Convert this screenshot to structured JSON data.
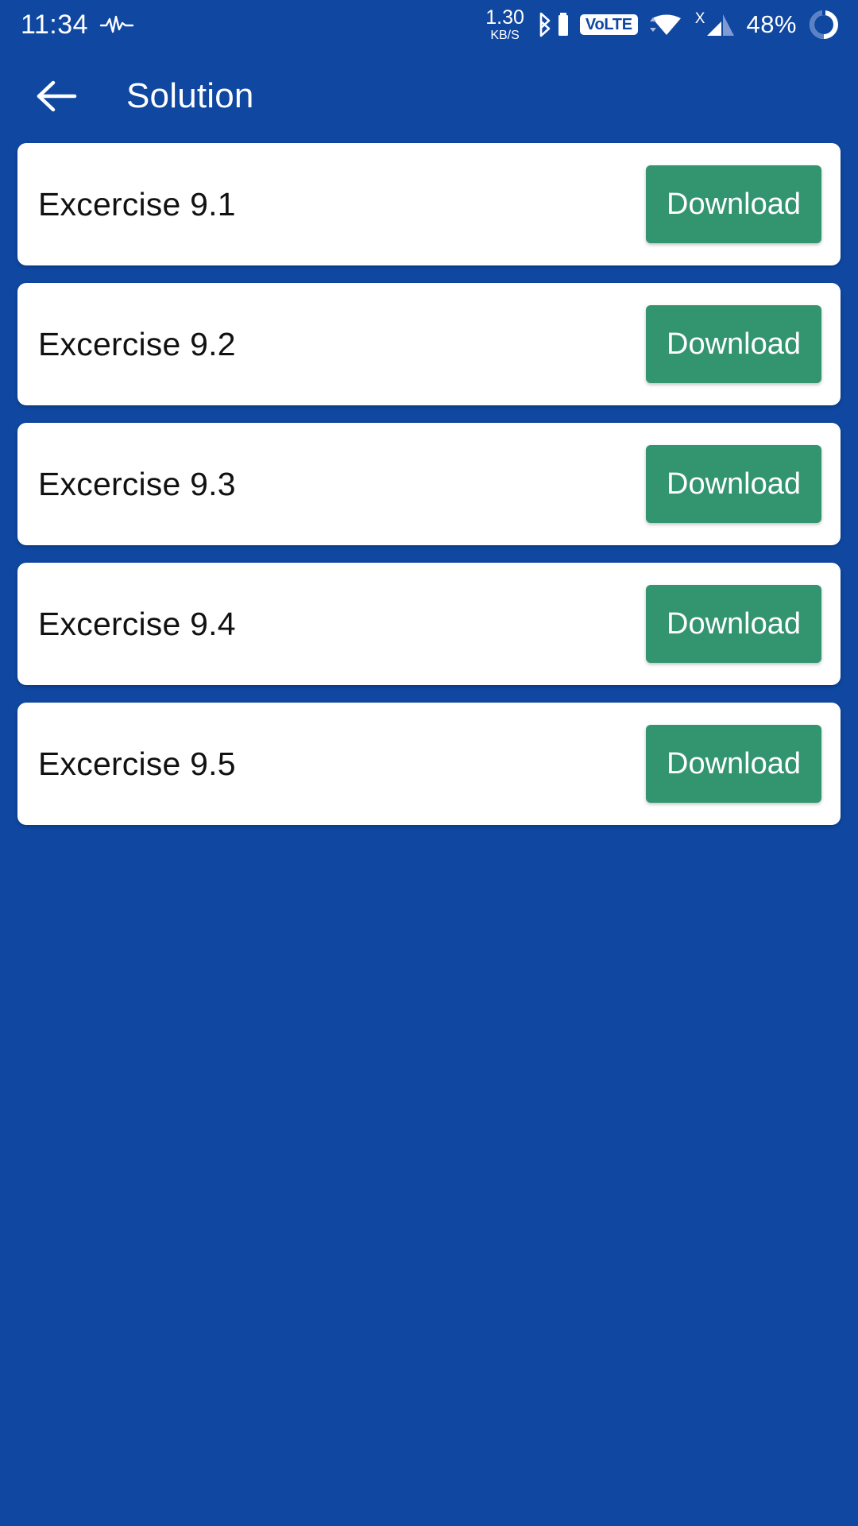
{
  "theme": {
    "background_blue": "#0F47A1",
    "card_white": "#FFFFFF",
    "button_green": "#339470",
    "text_dark": "#111111",
    "text_light": "#FFFFFF"
  },
  "status_bar": {
    "clock": "11:34",
    "pulse_icon": "pulse-icon",
    "network_speed_value": "1.30",
    "network_speed_unit": "KB/S",
    "bluetooth_icon": "bluetooth-icon",
    "bluetooth_battery_icon": "bluetooth-battery-icon",
    "volte_label": "VoLTE",
    "wifi_icon": "wifi-icon",
    "signal_icon": "signal-bars-icon",
    "signal_no_sim_mark": "X",
    "battery_percent": "48%",
    "battery_ring_icon": "battery-ring-icon"
  },
  "app_bar": {
    "back_icon": "arrow-left-icon",
    "title": "Solution"
  },
  "list": {
    "items": [
      {
        "label": "Excercise 9.1",
        "action_label": "Download"
      },
      {
        "label": "Excercise 9.2",
        "action_label": "Download"
      },
      {
        "label": "Excercise 9.3",
        "action_label": "Download"
      },
      {
        "label": "Excercise 9.4",
        "action_label": "Download"
      },
      {
        "label": "Excercise 9.5",
        "action_label": "Download"
      }
    ]
  }
}
